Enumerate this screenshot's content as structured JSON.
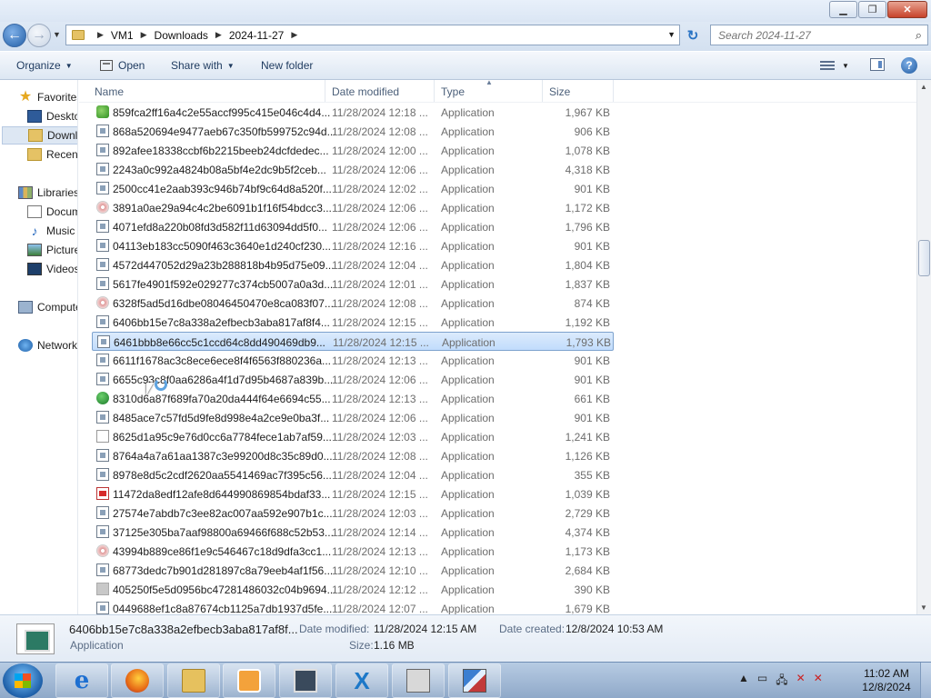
{
  "window": {
    "minimize_icon": "minimize-icon",
    "maximize_icon": "restore-icon",
    "close_icon": "close-icon"
  },
  "address": {
    "crumbs": [
      "VM1",
      "Downloads",
      "2024-11-27"
    ],
    "search_placeholder": "Search 2024-11-27"
  },
  "toolbar": {
    "organize": "Organize",
    "open": "Open",
    "share_with": "Share with",
    "new_folder": "New folder"
  },
  "nav": {
    "favorites": "Favorites",
    "desktop": "Desktop",
    "downloads": "Downloads",
    "recent": "Recent Places",
    "libraries": "Libraries",
    "documents": "Documents",
    "music": "Music",
    "pictures": "Pictures",
    "videos": "Videos",
    "computer": "Computer",
    "network": "Network"
  },
  "columns": {
    "name": "Name",
    "date": "Date modified",
    "type": "Type",
    "size": "Size"
  },
  "files": [
    {
      "name": "859fca2ff16a4c2e55accf995c415e046c4d4...",
      "date": "11/28/2024 12:18 ...",
      "type": "Application",
      "size": "1,967 KB",
      "icon": "leaf"
    },
    {
      "name": "868a520694e9477aeb67c350fb599752c94d...",
      "date": "11/28/2024 12:08 ...",
      "type": "Application",
      "size": "906 KB",
      "icon": "app"
    },
    {
      "name": "892afee18338ccbf6b2215beeb24dcfdedec...",
      "date": "11/28/2024 12:00 ...",
      "type": "Application",
      "size": "1,078 KB",
      "icon": "app"
    },
    {
      "name": "2243a0c992a4824b08a5bf4e2dc9b5f2ceb...",
      "date": "11/28/2024 12:06 ...",
      "type": "Application",
      "size": "4,318 KB",
      "icon": "app"
    },
    {
      "name": "2500cc41e2aab393c946b74bf9c64d8a520f...",
      "date": "11/28/2024 12:02 ...",
      "type": "Application",
      "size": "901 KB",
      "icon": "app"
    },
    {
      "name": "3891a0ae29a94c4c2be6091b1f16f54bdcc3...",
      "date": "11/28/2024 12:06 ...",
      "type": "Application",
      "size": "1,172 KB",
      "icon": "disc"
    },
    {
      "name": "4071efd8a220b08fd3d582f11d63094dd5f0...",
      "date": "11/28/2024 12:06 ...",
      "type": "Application",
      "size": "1,796 KB",
      "icon": "app"
    },
    {
      "name": "04113eb183cc5090f463c3640e1d240cf230...",
      "date": "11/28/2024 12:16 ...",
      "type": "Application",
      "size": "901 KB",
      "icon": "app"
    },
    {
      "name": "4572d447052d29a23b288818b4b95d75e09...",
      "date": "11/28/2024 12:04 ...",
      "type": "Application",
      "size": "1,804 KB",
      "icon": "app"
    },
    {
      "name": "5617fe4901f592e029277c374cb5007a0a3d...",
      "date": "11/28/2024 12:01 ...",
      "type": "Application",
      "size": "1,837 KB",
      "icon": "app"
    },
    {
      "name": "6328f5ad5d16dbe08046450470e8ca083f07...",
      "date": "11/28/2024 12:08 ...",
      "type": "Application",
      "size": "874 KB",
      "icon": "disc"
    },
    {
      "name": "6406bb15e7c8a338a2efbecb3aba817af8f4...",
      "date": "11/28/2024 12:15 ...",
      "type": "Application",
      "size": "1,192 KB",
      "icon": "app"
    },
    {
      "name": "6461bbb8e66cc5c1ccd64c8dd490469db9...",
      "date": "11/28/2024 12:15 ...",
      "type": "Application",
      "size": "1,793 KB",
      "icon": "app",
      "selected": true
    },
    {
      "name": "6611f1678ac3c8ece6ece8f4f6563f880236a...",
      "date": "11/28/2024 12:13 ...",
      "type": "Application",
      "size": "901 KB",
      "icon": "app"
    },
    {
      "name": "6655c93c8f0aa6286a4f1d7d95b4687a839b...",
      "date": "11/28/2024 12:06 ...",
      "type": "Application",
      "size": "901 KB",
      "icon": "app"
    },
    {
      "name": "8310d6a87f689fa70a20da444f64e6694c55...",
      "date": "11/28/2024 12:13 ...",
      "type": "Application",
      "size": "661 KB",
      "icon": "green"
    },
    {
      "name": "8485ace7c57fd5d9fe8d998e4a2ce9e0ba3f...",
      "date": "11/28/2024 12:06 ...",
      "type": "Application",
      "size": "901 KB",
      "icon": "app"
    },
    {
      "name": "8625d1a95c9e76d0cc6a7784fece1ab7af59...",
      "date": "11/28/2024 12:03 ...",
      "type": "Application",
      "size": "1,241 KB",
      "icon": "doc"
    },
    {
      "name": "8764a4a7a61aa1387c3e99200d8c35c89d0...",
      "date": "11/28/2024 12:08 ...",
      "type": "Application",
      "size": "1,126 KB",
      "icon": "app"
    },
    {
      "name": "8978e8d5c2cdf2620aa5541469ac7f395c56...",
      "date": "11/28/2024 12:04 ...",
      "type": "Application",
      "size": "355 KB",
      "icon": "app"
    },
    {
      "name": "11472da8edf12afe8d644990869854bdaf33...",
      "date": "11/28/2024 12:15 ...",
      "type": "Application",
      "size": "1,039 KB",
      "icon": "red"
    },
    {
      "name": "27574e7abdb7c3ee82ac007aa592e907b1c...",
      "date": "11/28/2024 12:03 ...",
      "type": "Application",
      "size": "2,729 KB",
      "icon": "app"
    },
    {
      "name": "37125e305ba7aaf98800a69466f688c52b53...",
      "date": "11/28/2024 12:14 ...",
      "type": "Application",
      "size": "4,374 KB",
      "icon": "app"
    },
    {
      "name": "43994b889ce86f1e9c546467c18d9dfa3cc1...",
      "date": "11/28/2024 12:13 ...",
      "type": "Application",
      "size": "1,173 KB",
      "icon": "disc"
    },
    {
      "name": "68773dedc7b901d281897c8a79eeb4af1f56...",
      "date": "11/28/2024 12:10 ...",
      "type": "Application",
      "size": "2,684 KB",
      "icon": "app"
    },
    {
      "name": "405250f5e5d0956bc47281486032c04b9694...",
      "date": "11/28/2024 12:12 ...",
      "type": "Application",
      "size": "390 KB",
      "icon": "gray"
    },
    {
      "name": "0449688ef1c8a87674cb1125a7db1937d5fe...",
      "date": "11/28/2024 12:07 ...",
      "type": "Application",
      "size": "1,679 KB",
      "icon": "app"
    }
  ],
  "details": {
    "filename": "6406bb15e7c8a338a2efbecb3aba817af8f...",
    "type": "Application",
    "date_modified_label": "Date modified:",
    "date_modified": "11/28/2024 12:15 AM",
    "date_created_label": "Date created:",
    "date_created": "12/8/2024 10:53 AM",
    "size_label": "Size:",
    "size": "1.16 MB"
  },
  "taskbar": {
    "time": "11:02 AM",
    "date": "12/8/2024",
    "apps": [
      "internet-explorer",
      "firefox",
      "file-explorer",
      "media-player",
      "remote-desktop",
      "x-app",
      "disk-utility",
      "tools-app"
    ]
  }
}
